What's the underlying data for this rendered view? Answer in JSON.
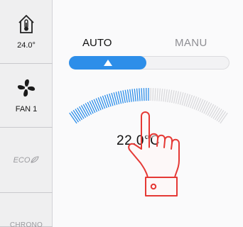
{
  "sidebar": {
    "temperature": {
      "icon": "thermometer-house-icon",
      "value": "24.0°"
    },
    "fan": {
      "icon": "fan-icon",
      "label": "FAN 1"
    },
    "eco": {
      "icon": "leaf-icon",
      "label": "ECO"
    },
    "chrono": {
      "label": "CHRONO"
    }
  },
  "mode": {
    "auto_label": "AUTO",
    "manu_label": "MANU",
    "selected": "AUTO",
    "toggle_icon": "triangle-up-icon"
  },
  "dial": {
    "setpoint_text": "22.0°C",
    "active_color": "#2d8ee9",
    "inactive_color": "#d9d9dc",
    "level": 0.5
  },
  "overlay": {
    "icon": "pointing-hand-icon",
    "color": "#e53935"
  }
}
